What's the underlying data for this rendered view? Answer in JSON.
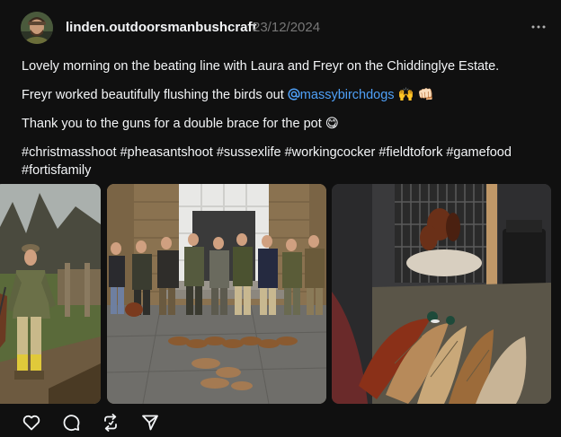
{
  "post": {
    "username": "linden.outdoorsmanbushcraft",
    "timestamp": "23/12/2024",
    "avatar_icon": "avatar-photo",
    "more_icon": "more-horizontal-icon",
    "caption": {
      "line1": "Lovely morning on the beating line with Laura and Freyr on the Chiddinglye Estate.",
      "line2_prefix": "Freyr worked beautifully flushing the birds out ",
      "line2_mention": "massybirchdogs",
      "line2_suffix": " 🙌 👊🏻",
      "line3": "Thank you to the guns for a double brace for the pot 😋",
      "hashtags": [
        "#christmasshoot",
        "#pheasantshoot",
        "#sussexlife",
        "#workingcocker",
        "#fieldtofork",
        "#gamefood",
        "#fortisfamily"
      ]
    },
    "photos": [
      {
        "name": "photo-beater-with-dog"
      },
      {
        "name": "photo-group-shoot-line"
      },
      {
        "name": "photo-dog-crate-and-pheasants"
      }
    ],
    "actions": [
      {
        "name": "like-button",
        "icon": "heart-icon"
      },
      {
        "name": "comment-button",
        "icon": "comment-icon"
      },
      {
        "name": "repost-button",
        "icon": "repost-icon"
      },
      {
        "name": "share-button",
        "icon": "send-icon"
      }
    ]
  },
  "colors": {
    "background": "#101010",
    "text": "#f3f5f7",
    "muted": "#777777",
    "link": "#4fa0f7"
  }
}
